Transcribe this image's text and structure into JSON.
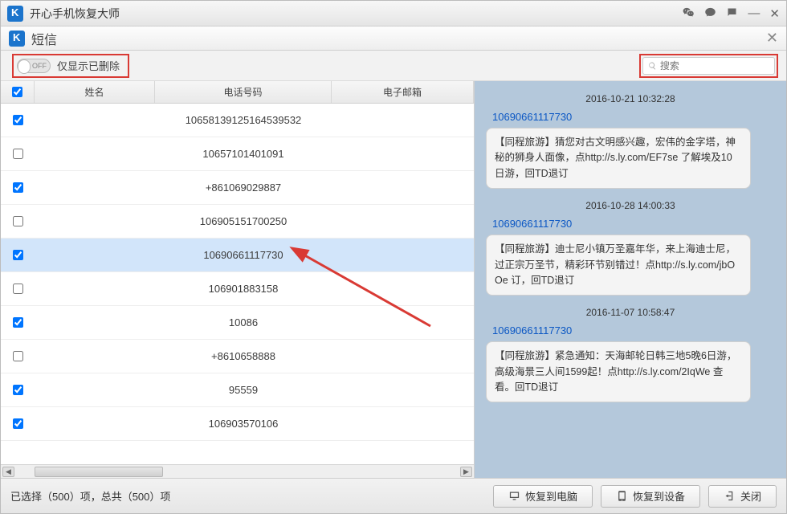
{
  "app": {
    "title": "开心手机恢复大师",
    "section": "短信"
  },
  "filter": {
    "switch_text": "OFF",
    "deleted_only_label": "仅显示已删除",
    "search_placeholder": "搜索"
  },
  "columns": {
    "name": "姓名",
    "phone": "电话号码",
    "email": "电子邮箱"
  },
  "rows": [
    {
      "checked": true,
      "name": "",
      "phone": "106581391251645395​32",
      "selected": false
    },
    {
      "checked": false,
      "name": "",
      "phone": "10657101401091",
      "selected": false
    },
    {
      "checked": true,
      "name": "",
      "phone": "+861069029887",
      "selected": false
    },
    {
      "checked": false,
      "name": "",
      "phone": "106905151700250",
      "selected": false
    },
    {
      "checked": true,
      "name": "",
      "phone": "10690661117730",
      "selected": true
    },
    {
      "checked": false,
      "name": "",
      "phone": "106901883158",
      "selected": false
    },
    {
      "checked": true,
      "name": "",
      "phone": "10086",
      "selected": false
    },
    {
      "checked": false,
      "name": "",
      "phone": "+8610658888",
      "selected": false
    },
    {
      "checked": true,
      "name": "",
      "phone": "95559",
      "selected": false
    },
    {
      "checked": true,
      "name": "",
      "phone": "106903570106",
      "selected": false
    }
  ],
  "messages": [
    {
      "time": "2016-10-21 10:32:28",
      "from": "10690661117730",
      "text": "【同程旅游】猜您对古文明感兴趣，宏伟的金字塔，神秘的狮身人面像，点http://s.ly.com/EF7se 了解埃及10日游，回TD退订"
    },
    {
      "time": "2016-10-28 14:00:33",
      "from": "10690661117730",
      "text": "【同程旅游】迪士尼小镇万圣嘉年华，来上海迪士尼，过正宗万圣节，精彩环节别错过！点http://s.ly.com/jbOOe 订，回TD退订"
    },
    {
      "time": "2016-11-07 10:58:47",
      "from": "10690661117730",
      "text": "【同程旅游】紧急通知：天海邮轮日韩三地5晚6日游，高级海景三人间1599起！点http://s.ly.com/2IqWe 查看。回TD退订"
    }
  ],
  "footer": {
    "status": "已选择（500）项，总共（500）项",
    "recover_pc": "恢复到电脑",
    "recover_dev": "恢复到设备",
    "close": "关闭"
  }
}
